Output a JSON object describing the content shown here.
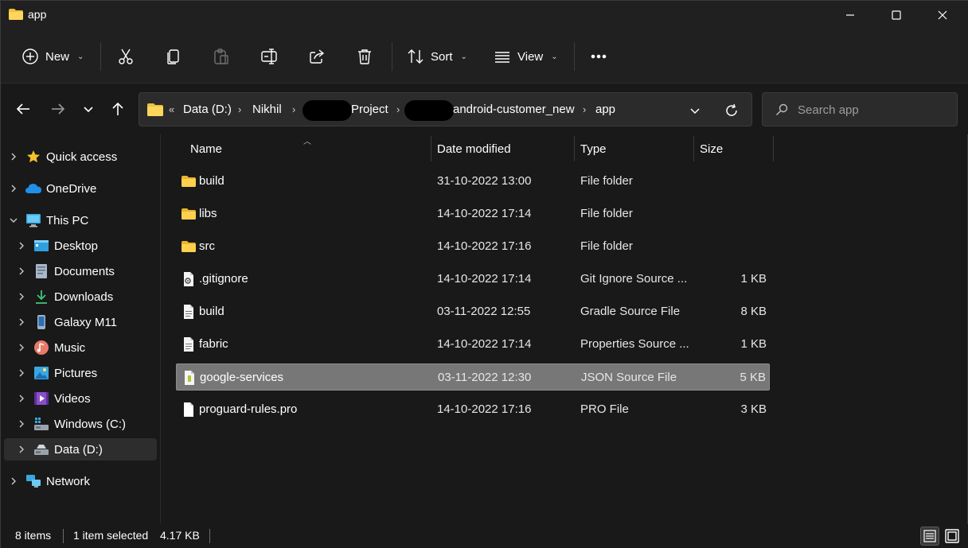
{
  "window": {
    "title": "app",
    "controls": [
      "minimize",
      "maximize",
      "close"
    ]
  },
  "toolbar": {
    "new_label": "New",
    "sort_label": "Sort",
    "view_label": "View",
    "icons": [
      "cut-icon",
      "copy-icon",
      "paste-icon",
      "rename-icon",
      "share-icon",
      "delete-icon",
      "more-icon"
    ]
  },
  "address": {
    "overflow": "«",
    "crumbs": [
      "Data (D:)",
      "Nikhil",
      "Project",
      "android-customer_new",
      "app"
    ],
    "separator": "›"
  },
  "search": {
    "placeholder": "Search app"
  },
  "sidebar": {
    "items": [
      {
        "label": "Quick access",
        "icon": "star-icon"
      },
      {
        "label": "OneDrive",
        "icon": "cloud-icon"
      },
      {
        "label": "This PC",
        "icon": "computer-icon"
      },
      {
        "label": "Desktop",
        "icon": "desktop-icon"
      },
      {
        "label": "Documents",
        "icon": "documents-icon"
      },
      {
        "label": "Downloads",
        "icon": "downloads-icon"
      },
      {
        "label": "Galaxy M11",
        "icon": "phone-icon"
      },
      {
        "label": "Music",
        "icon": "music-icon"
      },
      {
        "label": "Pictures",
        "icon": "pictures-icon"
      },
      {
        "label": "Videos",
        "icon": "videos-icon"
      },
      {
        "label": "Windows (C:)",
        "icon": "drive-icon"
      },
      {
        "label": "Data (D:)",
        "icon": "drive-icon"
      },
      {
        "label": "Network",
        "icon": "network-icon"
      }
    ],
    "selected": "Data (D:)"
  },
  "columns": {
    "name": "Name",
    "date": "Date modified",
    "type": "Type",
    "size": "Size"
  },
  "files": [
    {
      "name": "build",
      "date": "31-10-2022 13:00",
      "type": "File folder",
      "size": "",
      "icon": "folder-icon"
    },
    {
      "name": "libs",
      "date": "14-10-2022 17:14",
      "type": "File folder",
      "size": "",
      "icon": "folder-icon"
    },
    {
      "name": "src",
      "date": "14-10-2022 17:16",
      "type": "File folder",
      "size": "",
      "icon": "folder-icon"
    },
    {
      "name": ".gitignore",
      "date": "14-10-2022 17:14",
      "type": "Git Ignore Source ...",
      "size": "1 KB",
      "icon": "config-file-icon"
    },
    {
      "name": "build",
      "date": "03-11-2022 12:55",
      "type": "Gradle Source File",
      "size": "8 KB",
      "icon": "text-file-icon"
    },
    {
      "name": "fabric",
      "date": "14-10-2022 17:14",
      "type": "Properties Source ...",
      "size": "1 KB",
      "icon": "text-file-icon"
    },
    {
      "name": "google-services",
      "date": "03-11-2022 12:30",
      "type": "JSON Source File",
      "size": "5 KB",
      "icon": "json-file-icon"
    },
    {
      "name": "proguard-rules.pro",
      "date": "14-10-2022 17:16",
      "type": "PRO File",
      "size": "3 KB",
      "icon": "blank-file-icon"
    }
  ],
  "selected_file_index": 6,
  "status": {
    "count": "8 items",
    "selection": "1 item selected",
    "size": "4.17 KB"
  },
  "colors": {
    "background": "#191919",
    "chrome": "#202020",
    "folder": "#f0c23b",
    "selection": "#777777"
  }
}
